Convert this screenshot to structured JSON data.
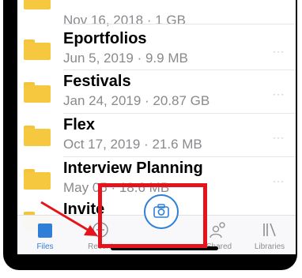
{
  "files": [
    {
      "name": "",
      "meta": "Nov 16, 2018 · 1 GB"
    },
    {
      "name": "Eportfolios",
      "meta": "Jun 5, 2019 · 9.9 MB"
    },
    {
      "name": "Festivals",
      "meta": "Jan 24, 2019 · 20.87 GB"
    },
    {
      "name": "Flex",
      "meta": "Oct 17, 2019 · 21.6 MB"
    },
    {
      "name": "Interview Planning",
      "meta": "May 05 · 18.6 MB"
    },
    {
      "name": "Invite",
      "meta": ""
    }
  ],
  "more_glyph": "···",
  "tabs": {
    "files": "Files",
    "recent": "Recent",
    "shared": "Shared",
    "libraries": "Libraries"
  },
  "colors": {
    "accent": "#2f7fd8",
    "folder": "#f6c83f",
    "annotation": "#e5141c"
  },
  "icons": [
    "folder-icon",
    "camera-icon",
    "clock-icon",
    "people-icon",
    "library-icon",
    "more-icon"
  ]
}
